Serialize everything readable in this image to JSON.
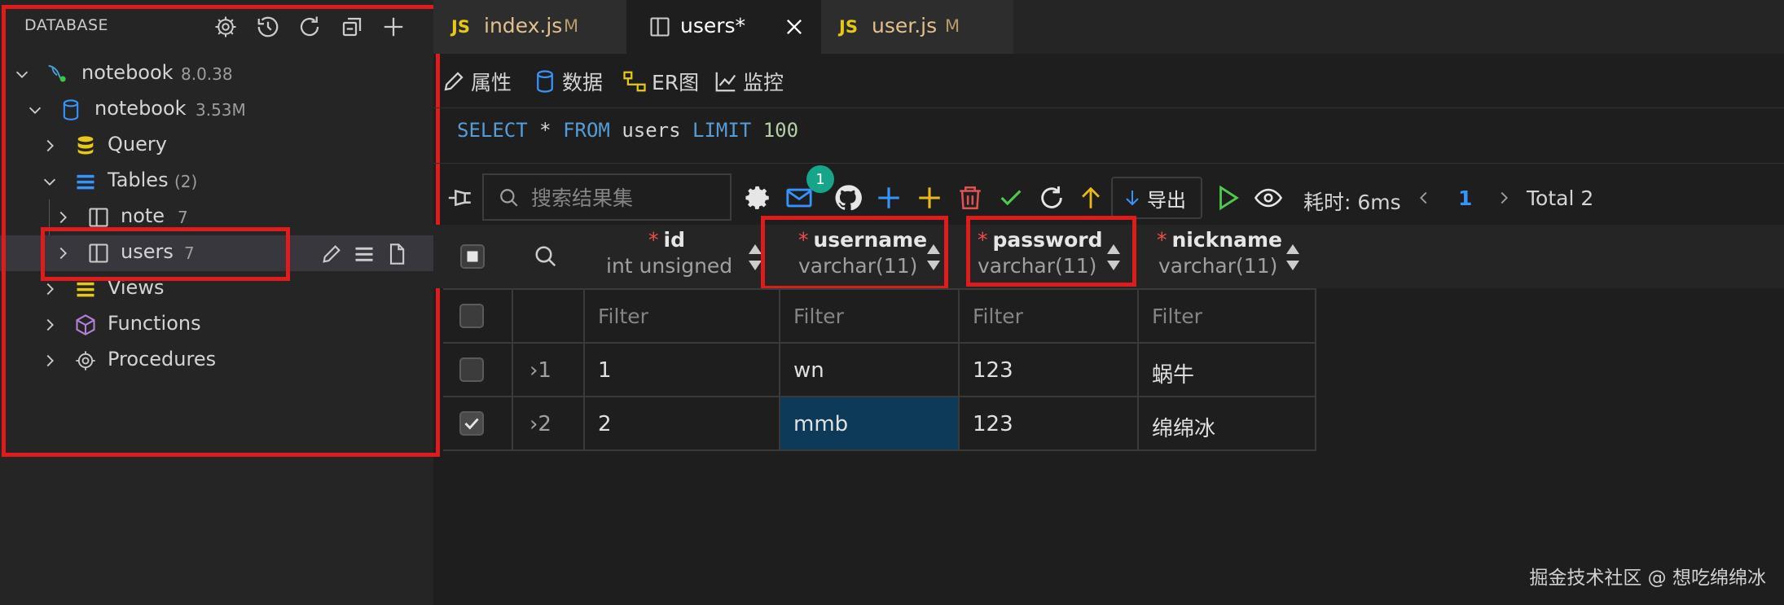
{
  "sidebar": {
    "title": "DATABASE",
    "connection": {
      "name": "notebook",
      "version": "8.0.38"
    },
    "database": {
      "name": "notebook",
      "size": "3.53M"
    },
    "items": [
      {
        "label": "Query"
      },
      {
        "label": "Tables",
        "count": "(2)"
      },
      {
        "label": "note",
        "count": "7"
      },
      {
        "label": "users",
        "count": "7"
      },
      {
        "label": "Views"
      },
      {
        "label": "Functions"
      },
      {
        "label": "Procedures"
      }
    ]
  },
  "tabs": [
    {
      "badge": "JS",
      "label": "index.js",
      "mod": "M"
    },
    {
      "label": "users*"
    },
    {
      "badge": "JS",
      "label": "user.js",
      "mod": "M"
    }
  ],
  "subtabs": [
    {
      "label": "属性"
    },
    {
      "label": "数据"
    },
    {
      "label": "ER图"
    },
    {
      "label": "监控"
    }
  ],
  "sql": {
    "select": "SELECT",
    "star": "*",
    "from": "FROM",
    "table": "users",
    "limit": "LIMIT",
    "n": "100"
  },
  "toolbar": {
    "search_placeholder": "搜索结果集",
    "badge": "1",
    "export_label": "导出",
    "time": "耗时: 6ms",
    "page": "1",
    "total": "Total 2"
  },
  "columns": [
    {
      "name": "id",
      "type": "int unsigned"
    },
    {
      "name": "username",
      "type": "varchar(11)"
    },
    {
      "name": "password",
      "type": "varchar(11)"
    },
    {
      "name": "nickname",
      "type": "varchar(11)"
    }
  ],
  "filter_placeholder": "Filter",
  "rows": [
    {
      "index": "1",
      "id": "1",
      "username": "wn",
      "password": "123",
      "nickname": "蜗牛",
      "checked": false
    },
    {
      "index": "2",
      "id": "2",
      "username": "mmb",
      "password": "123",
      "nickname": "绵绵冰",
      "checked": true
    }
  ],
  "colors": {
    "accent": "#3794ff",
    "highlight": "#e01b1b",
    "selected_cell": "#0d3a58"
  },
  "watermark": "掘金技术社区 @ 想吃绵绵冰"
}
